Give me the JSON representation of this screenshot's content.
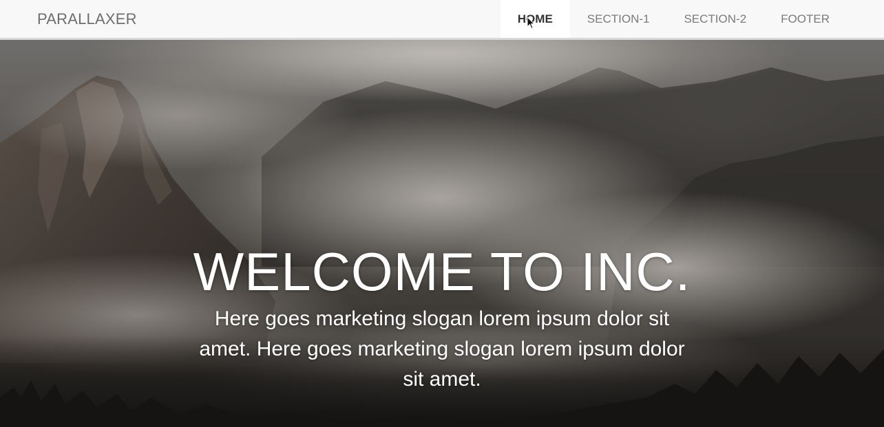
{
  "navbar": {
    "brand": "PARALLAXER",
    "items": [
      {
        "label": "HOME",
        "active": true
      },
      {
        "label": "SECTION-1",
        "active": false
      },
      {
        "label": "SECTION-2",
        "active": false
      },
      {
        "label": "FOOTER",
        "active": false
      }
    ]
  },
  "hero": {
    "title": "WELCOME TO INC.",
    "slogan": "Here goes marketing slogan lorem ipsum dolor sit amet. Here goes marketing slogan lorem ipsum dolor sit amet.",
    "background": "misty-mountains-image"
  },
  "colors": {
    "navbar_bg": "#f8f8f8",
    "nav_active_bg": "#ffffff",
    "nav_text": "#7a7a7a",
    "nav_active_text": "#333333",
    "hero_text": "#ffffff"
  },
  "cursor": "arrow-pointer-icon"
}
